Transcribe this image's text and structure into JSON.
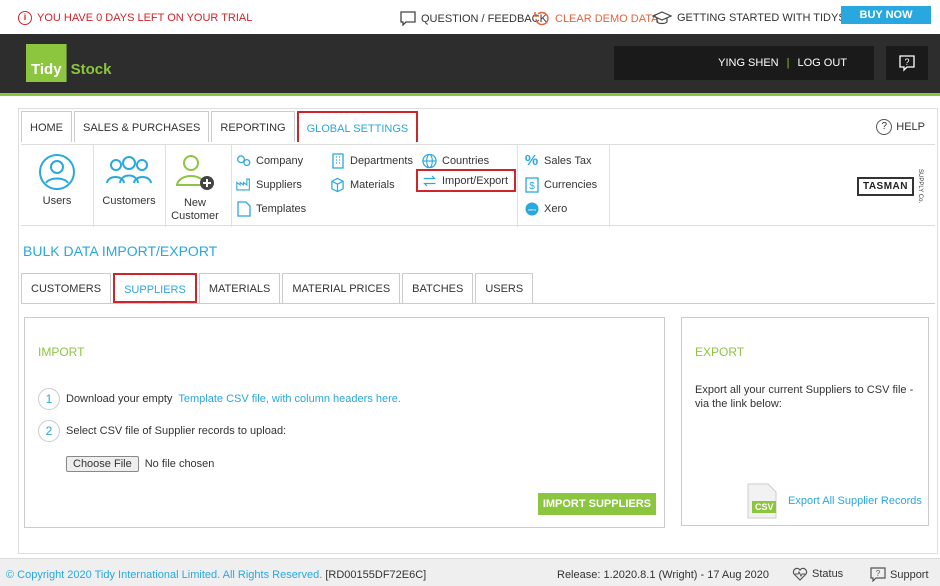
{
  "topbar": {
    "trial_text": "YOU HAVE 0 DAYS LEFT ON YOUR TRIAL",
    "feedback": "QUESTION / FEEDBACK",
    "clear_demo": "CLEAR DEMO DATA",
    "getting_started": "GETTING STARTED WITH TIDYSTOCK",
    "buy_now": "BUY NOW"
  },
  "header": {
    "logo_tidy": "Tidy",
    "logo_stock": "Stock",
    "user_name": "YING SHEN",
    "separator": "|",
    "logout": "LOG OUT"
  },
  "nav": {
    "tabs": [
      {
        "label": "HOME"
      },
      {
        "label": "SALES & PURCHASES"
      },
      {
        "label": "REPORTING"
      },
      {
        "label": "GLOBAL SETTINGS",
        "active": true
      }
    ],
    "help": "HELP"
  },
  "ribbon": {
    "big_items": [
      {
        "label": "Users",
        "icon": "user-circle-icon"
      },
      {
        "label": "Customers",
        "icon": "customers-icon"
      },
      {
        "label": "New Customer",
        "icon": "add-user-icon"
      }
    ],
    "col1": [
      {
        "label": "Company",
        "icon": "gears-icon"
      },
      {
        "label": "Suppliers",
        "icon": "factory-icon"
      },
      {
        "label": "Templates",
        "icon": "document-icon"
      }
    ],
    "col2": [
      {
        "label": "Departments",
        "icon": "building-icon"
      },
      {
        "label": "Materials",
        "icon": "cube-icon"
      }
    ],
    "col3": [
      {
        "label": "Countries",
        "icon": "globe-icon"
      },
      {
        "label": "Import/Export",
        "icon": "arrows-icon"
      }
    ],
    "col4": [
      {
        "label": "Sales Tax",
        "icon": "percent-icon"
      },
      {
        "label": "Currencies",
        "icon": "dollar-icon"
      },
      {
        "label": "Xero",
        "icon": "xero-icon"
      }
    ],
    "brand": {
      "name": "TASMAN",
      "sub": "SUPPLY Co."
    }
  },
  "page": {
    "title": "BULK DATA IMPORT/EXPORT",
    "subtabs": [
      {
        "label": "CUSTOMERS"
      },
      {
        "label": "SUPPLIERS",
        "active": true
      },
      {
        "label": "MATERIALS"
      },
      {
        "label": "MATERIAL PRICES"
      },
      {
        "label": "BATCHES"
      },
      {
        "label": "USERS"
      }
    ]
  },
  "import": {
    "title": "IMPORT",
    "step1_num": "1",
    "step1_text": "Download your empty",
    "step1_link": "Template CSV file, with column headers here.",
    "step2_num": "2",
    "step2_text": "Select CSV file of Supplier records to upload:",
    "choose_file": "Choose File",
    "no_file": "No file chosen",
    "button": "IMPORT SUPPLIERS"
  },
  "export": {
    "title": "EXPORT",
    "description": "Export all your current Suppliers to CSV file - via the link below:",
    "csv_label": "CSV",
    "link": "Export All Supplier Records"
  },
  "footer": {
    "copyright": "© Copyright 2020 Tidy International Limited. All Rights Reserved.",
    "code": "[RD00155DF72E6C]",
    "release": "Release: 1.2020.8.1 (Wright) - 17 Aug 2020",
    "status": "Status",
    "support": "Support"
  },
  "colors": {
    "accent": "#29a8e0",
    "brand_green": "#8cc63f",
    "alert_red": "#d0242b",
    "header_bg": "#2d2d2d"
  }
}
